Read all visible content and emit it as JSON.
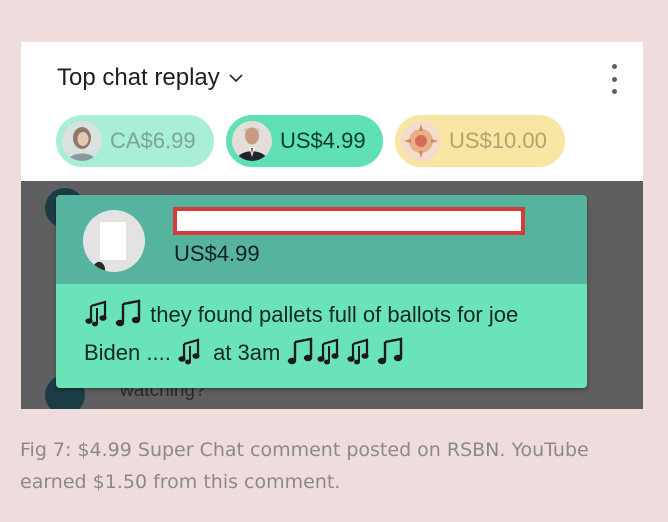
{
  "chat_header": {
    "title": "Top chat replay",
    "dropdown_icon": "chevron-down-icon",
    "menu_icon": "more-vert-icon"
  },
  "superchat_pills": [
    {
      "amount": "CA$6.99",
      "color": "#a9eed8"
    },
    {
      "amount": "US$4.99",
      "color": "#5fe0b5"
    },
    {
      "amount": "US$10.00",
      "color": "#f8e6a3"
    }
  ],
  "background_message": {
    "partial_text": "watching?"
  },
  "superchat_card": {
    "amount": "US$4.99",
    "username_redacted": true,
    "message_parts": [
      {
        "type": "icon",
        "icon": "notes-icon"
      },
      {
        "type": "icon",
        "icon": "music-note-icon"
      },
      {
        "type": "text",
        "text": " they found pallets full of ballots for joe Biden .... "
      },
      {
        "type": "icon",
        "icon": "notes-icon"
      },
      {
        "type": "text",
        "text": " at 3am "
      },
      {
        "type": "icon",
        "icon": "music-note-icon"
      },
      {
        "type": "icon",
        "icon": "notes-icon"
      },
      {
        "type": "icon",
        "icon": "notes-icon"
      },
      {
        "type": "icon",
        "icon": "music-note-icon"
      }
    ],
    "header_color": "#56b39e",
    "body_color": "#6ae3b8",
    "redaction_border_color": "#d43c3c"
  },
  "caption": "Fig 7: $4.99 Super Chat comment posted on RSBN. YouTube earned $1.50 from this comment."
}
